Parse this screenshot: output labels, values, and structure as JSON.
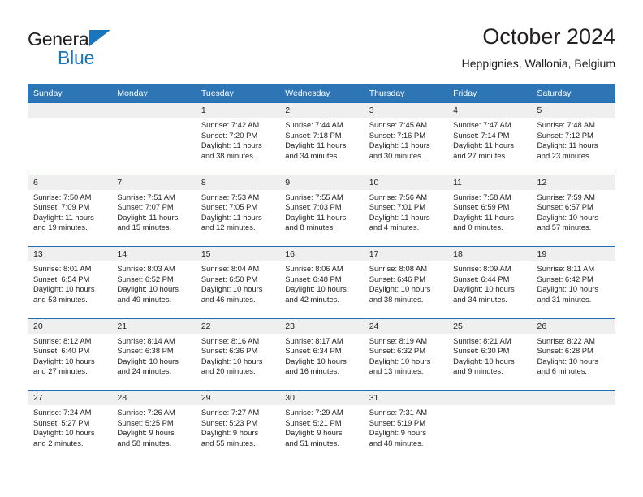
{
  "brand": {
    "name_top": "General",
    "name_bottom": "Blue",
    "accent_color": "#1b75bb"
  },
  "header": {
    "title": "October 2024",
    "subtitle": "Heppignies, Wallonia, Belgium"
  },
  "calendar": {
    "header_bg": "#2e75b6",
    "row_border": "#1f6eb5",
    "daynum_bg": "#efefef",
    "weekdays": [
      "Sunday",
      "Monday",
      "Tuesday",
      "Wednesday",
      "Thursday",
      "Friday",
      "Saturday"
    ],
    "weeks": [
      [
        {
          "day": "",
          "sunrise": "",
          "sunset": "",
          "daylight_1": "",
          "daylight_2": ""
        },
        {
          "day": "",
          "sunrise": "",
          "sunset": "",
          "daylight_1": "",
          "daylight_2": ""
        },
        {
          "day": "1",
          "sunrise": "Sunrise: 7:42 AM",
          "sunset": "Sunset: 7:20 PM",
          "daylight_1": "Daylight: 11 hours",
          "daylight_2": "and 38 minutes."
        },
        {
          "day": "2",
          "sunrise": "Sunrise: 7:44 AM",
          "sunset": "Sunset: 7:18 PM",
          "daylight_1": "Daylight: 11 hours",
          "daylight_2": "and 34 minutes."
        },
        {
          "day": "3",
          "sunrise": "Sunrise: 7:45 AM",
          "sunset": "Sunset: 7:16 PM",
          "daylight_1": "Daylight: 11 hours",
          "daylight_2": "and 30 minutes."
        },
        {
          "day": "4",
          "sunrise": "Sunrise: 7:47 AM",
          "sunset": "Sunset: 7:14 PM",
          "daylight_1": "Daylight: 11 hours",
          "daylight_2": "and 27 minutes."
        },
        {
          "day": "5",
          "sunrise": "Sunrise: 7:48 AM",
          "sunset": "Sunset: 7:12 PM",
          "daylight_1": "Daylight: 11 hours",
          "daylight_2": "and 23 minutes."
        }
      ],
      [
        {
          "day": "6",
          "sunrise": "Sunrise: 7:50 AM",
          "sunset": "Sunset: 7:09 PM",
          "daylight_1": "Daylight: 11 hours",
          "daylight_2": "and 19 minutes."
        },
        {
          "day": "7",
          "sunrise": "Sunrise: 7:51 AM",
          "sunset": "Sunset: 7:07 PM",
          "daylight_1": "Daylight: 11 hours",
          "daylight_2": "and 15 minutes."
        },
        {
          "day": "8",
          "sunrise": "Sunrise: 7:53 AM",
          "sunset": "Sunset: 7:05 PM",
          "daylight_1": "Daylight: 11 hours",
          "daylight_2": "and 12 minutes."
        },
        {
          "day": "9",
          "sunrise": "Sunrise: 7:55 AM",
          "sunset": "Sunset: 7:03 PM",
          "daylight_1": "Daylight: 11 hours",
          "daylight_2": "and 8 minutes."
        },
        {
          "day": "10",
          "sunrise": "Sunrise: 7:56 AM",
          "sunset": "Sunset: 7:01 PM",
          "daylight_1": "Daylight: 11 hours",
          "daylight_2": "and 4 minutes."
        },
        {
          "day": "11",
          "sunrise": "Sunrise: 7:58 AM",
          "sunset": "Sunset: 6:59 PM",
          "daylight_1": "Daylight: 11 hours",
          "daylight_2": "and 0 minutes."
        },
        {
          "day": "12",
          "sunrise": "Sunrise: 7:59 AM",
          "sunset": "Sunset: 6:57 PM",
          "daylight_1": "Daylight: 10 hours",
          "daylight_2": "and 57 minutes."
        }
      ],
      [
        {
          "day": "13",
          "sunrise": "Sunrise: 8:01 AM",
          "sunset": "Sunset: 6:54 PM",
          "daylight_1": "Daylight: 10 hours",
          "daylight_2": "and 53 minutes."
        },
        {
          "day": "14",
          "sunrise": "Sunrise: 8:03 AM",
          "sunset": "Sunset: 6:52 PM",
          "daylight_1": "Daylight: 10 hours",
          "daylight_2": "and 49 minutes."
        },
        {
          "day": "15",
          "sunrise": "Sunrise: 8:04 AM",
          "sunset": "Sunset: 6:50 PM",
          "daylight_1": "Daylight: 10 hours",
          "daylight_2": "and 46 minutes."
        },
        {
          "day": "16",
          "sunrise": "Sunrise: 8:06 AM",
          "sunset": "Sunset: 6:48 PM",
          "daylight_1": "Daylight: 10 hours",
          "daylight_2": "and 42 minutes."
        },
        {
          "day": "17",
          "sunrise": "Sunrise: 8:08 AM",
          "sunset": "Sunset: 6:46 PM",
          "daylight_1": "Daylight: 10 hours",
          "daylight_2": "and 38 minutes."
        },
        {
          "day": "18",
          "sunrise": "Sunrise: 8:09 AM",
          "sunset": "Sunset: 6:44 PM",
          "daylight_1": "Daylight: 10 hours",
          "daylight_2": "and 34 minutes."
        },
        {
          "day": "19",
          "sunrise": "Sunrise: 8:11 AM",
          "sunset": "Sunset: 6:42 PM",
          "daylight_1": "Daylight: 10 hours",
          "daylight_2": "and 31 minutes."
        }
      ],
      [
        {
          "day": "20",
          "sunrise": "Sunrise: 8:12 AM",
          "sunset": "Sunset: 6:40 PM",
          "daylight_1": "Daylight: 10 hours",
          "daylight_2": "and 27 minutes."
        },
        {
          "day": "21",
          "sunrise": "Sunrise: 8:14 AM",
          "sunset": "Sunset: 6:38 PM",
          "daylight_1": "Daylight: 10 hours",
          "daylight_2": "and 24 minutes."
        },
        {
          "day": "22",
          "sunrise": "Sunrise: 8:16 AM",
          "sunset": "Sunset: 6:36 PM",
          "daylight_1": "Daylight: 10 hours",
          "daylight_2": "and 20 minutes."
        },
        {
          "day": "23",
          "sunrise": "Sunrise: 8:17 AM",
          "sunset": "Sunset: 6:34 PM",
          "daylight_1": "Daylight: 10 hours",
          "daylight_2": "and 16 minutes."
        },
        {
          "day": "24",
          "sunrise": "Sunrise: 8:19 AM",
          "sunset": "Sunset: 6:32 PM",
          "daylight_1": "Daylight: 10 hours",
          "daylight_2": "and 13 minutes."
        },
        {
          "day": "25",
          "sunrise": "Sunrise: 8:21 AM",
          "sunset": "Sunset: 6:30 PM",
          "daylight_1": "Daylight: 10 hours",
          "daylight_2": "and 9 minutes."
        },
        {
          "day": "26",
          "sunrise": "Sunrise: 8:22 AM",
          "sunset": "Sunset: 6:28 PM",
          "daylight_1": "Daylight: 10 hours",
          "daylight_2": "and 6 minutes."
        }
      ],
      [
        {
          "day": "27",
          "sunrise": "Sunrise: 7:24 AM",
          "sunset": "Sunset: 5:27 PM",
          "daylight_1": "Daylight: 10 hours",
          "daylight_2": "and 2 minutes."
        },
        {
          "day": "28",
          "sunrise": "Sunrise: 7:26 AM",
          "sunset": "Sunset: 5:25 PM",
          "daylight_1": "Daylight: 9 hours",
          "daylight_2": "and 58 minutes."
        },
        {
          "day": "29",
          "sunrise": "Sunrise: 7:27 AM",
          "sunset": "Sunset: 5:23 PM",
          "daylight_1": "Daylight: 9 hours",
          "daylight_2": "and 55 minutes."
        },
        {
          "day": "30",
          "sunrise": "Sunrise: 7:29 AM",
          "sunset": "Sunset: 5:21 PM",
          "daylight_1": "Daylight: 9 hours",
          "daylight_2": "and 51 minutes."
        },
        {
          "day": "31",
          "sunrise": "Sunrise: 7:31 AM",
          "sunset": "Sunset: 5:19 PM",
          "daylight_1": "Daylight: 9 hours",
          "daylight_2": "and 48 minutes."
        },
        {
          "day": "",
          "sunrise": "",
          "sunset": "",
          "daylight_1": "",
          "daylight_2": ""
        },
        {
          "day": "",
          "sunrise": "",
          "sunset": "",
          "daylight_1": "",
          "daylight_2": ""
        }
      ]
    ]
  }
}
